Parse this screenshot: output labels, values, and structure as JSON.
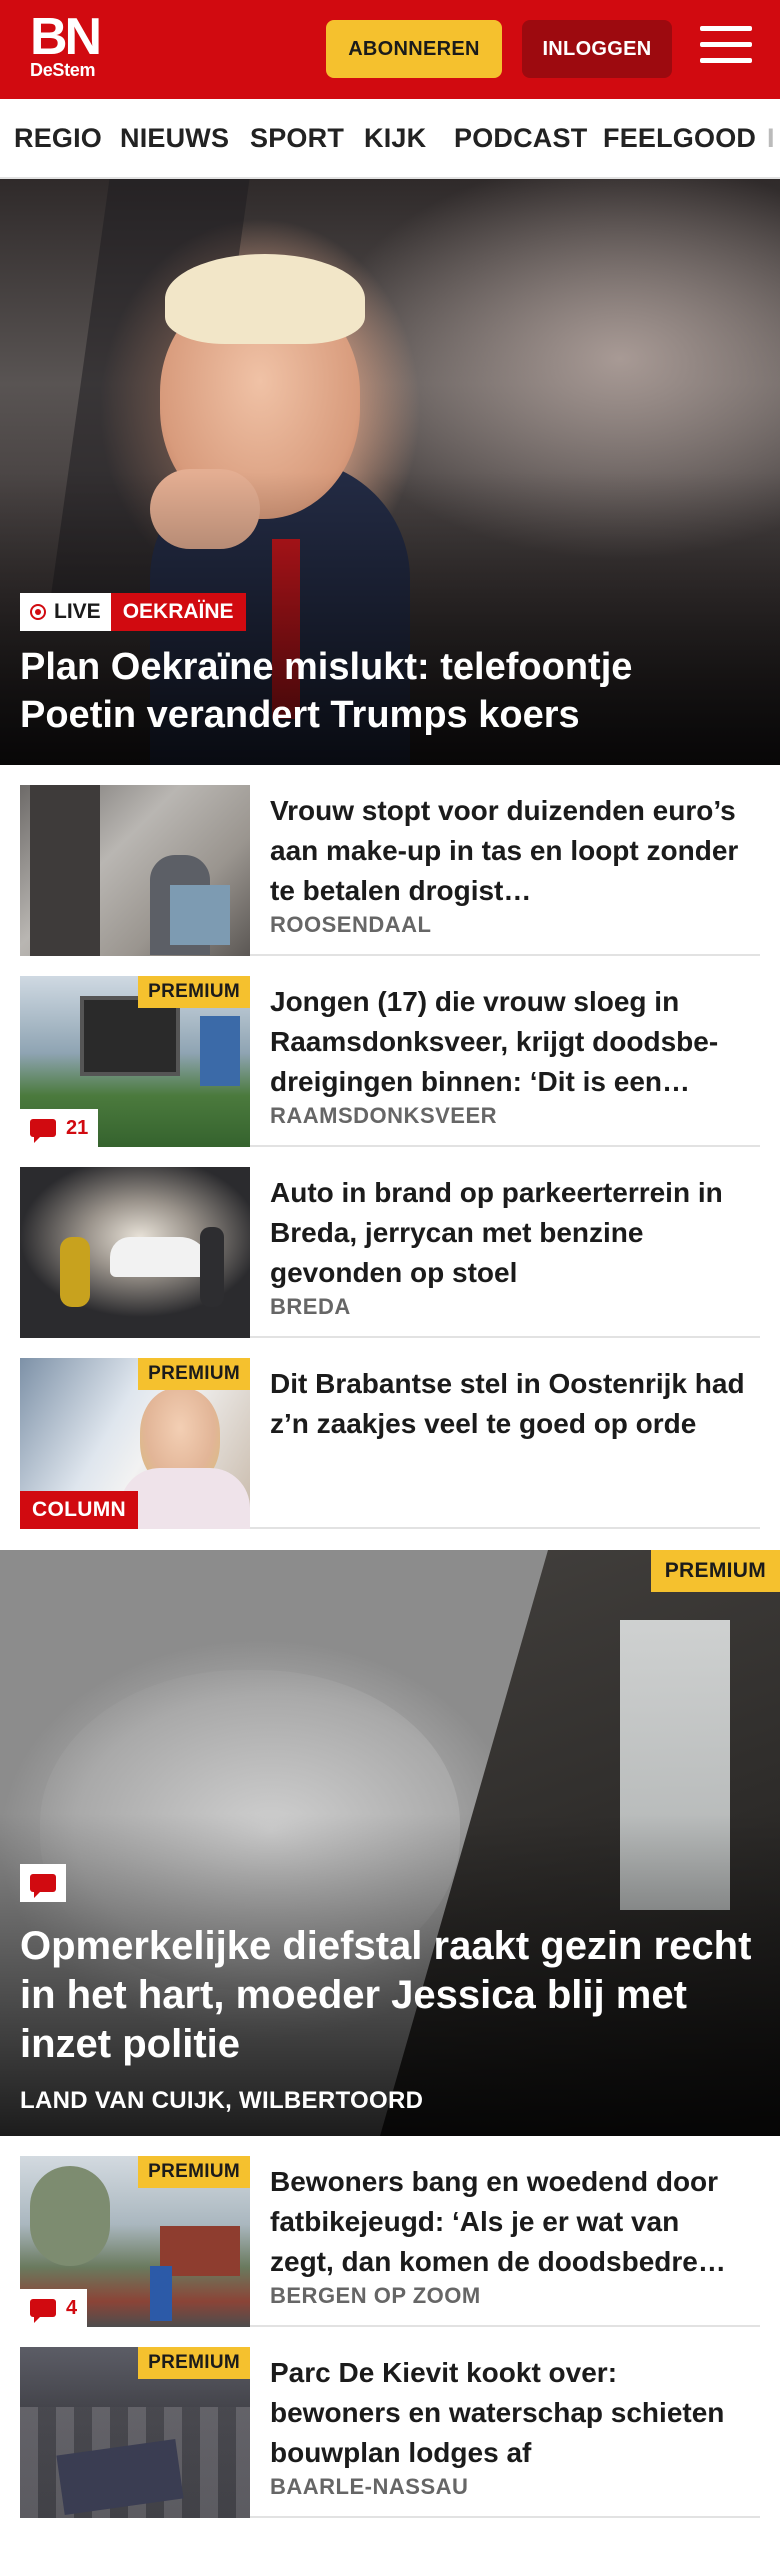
{
  "header": {
    "logo_main": "BN",
    "logo_sub": "DeStem",
    "subscribe_label": "ABONNEREN",
    "login_label": "INLOGGEN"
  },
  "nav": {
    "items": [
      "REGIO",
      "NIEUWS",
      "SPORT",
      "KIJK",
      "PODCAST",
      "FEELGOOD",
      "I"
    ]
  },
  "hero": {
    "live_label": "LIVE",
    "tag": "OEKRAÏNE",
    "title": "Plan Oekraïne mislukt: telefoontje Poetin verandert Trumps koers"
  },
  "articles": [
    {
      "title": "Vrouw stopt voor duizenden euro’s aan make-up in tas en loopt zonder te betalen drogist…",
      "location": "ROOSENDAAL",
      "premium": "",
      "comments": "",
      "column": ""
    },
    {
      "title": "Jongen (17) die vrouw sloeg in Raamsdonksveer, krijgt doodsbe-dreigingen binnen: ‘Dit is een…",
      "location": "RAAMSDONKSVEER",
      "premium": "PREMIUM",
      "comments": "21",
      "column": ""
    },
    {
      "title": "Auto in brand op parkeerterrein in Breda, jerrycan met benzine gevonden op stoel",
      "location": "BREDA",
      "premium": "",
      "comments": "",
      "column": ""
    },
    {
      "title": "Dit Brabantse stel in Oostenrijk had z’n zaakjes veel te goed op orde",
      "location": "",
      "premium": "PREMIUM",
      "comments": "",
      "column": "COLUMN"
    }
  ],
  "feature": {
    "premium": "PREMIUM",
    "title": "Opmerkelijke diefstal raakt gezin recht in het hart, moeder Jessica blij met inzet politie",
    "location": "LAND VAN CUIJK, WILBERTOORD"
  },
  "articles_2": [
    {
      "title": "Bewoners bang en woedend door fatbikejeugd: ‘Als je er wat van zegt, dan komen de doodsbedre…",
      "location": "BERGEN OP ZOOM",
      "premium": "PREMIUM",
      "comments": "4"
    },
    {
      "title": "Parc De Kievit kookt over: bewoners en waterschap schieten bouwplan lodges af",
      "location": "BAARLE-NASSAU",
      "premium": "PREMIUM",
      "comments": ""
    }
  ],
  "colors": {
    "brand_red": "#d10a10",
    "subscribe_yellow": "#f5c12e",
    "login_dark_red": "#9d0a0f"
  }
}
